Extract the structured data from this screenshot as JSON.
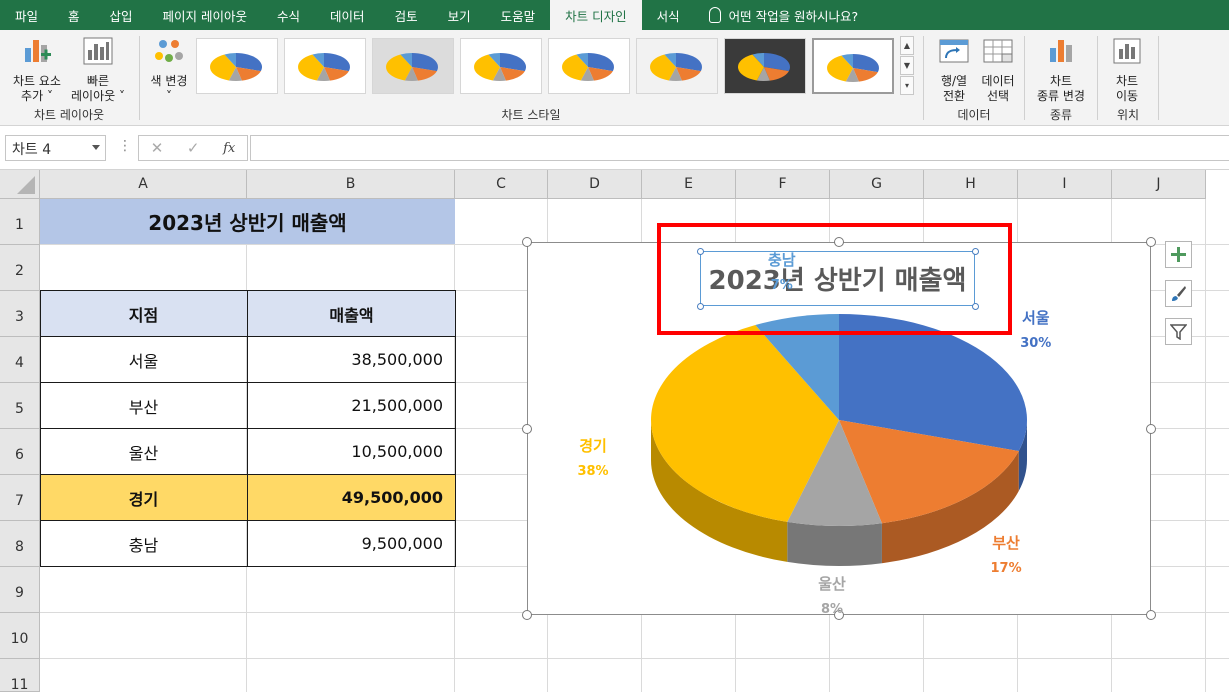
{
  "ribbon_tabs": [
    "파일",
    "홈",
    "삽입",
    "페이지 레이아웃",
    "수식",
    "데이터",
    "검토",
    "보기",
    "도움말",
    "차트 디자인",
    "서식"
  ],
  "active_tab": "차트 디자인",
  "tell_me": "어떤 작업을 원하시나요?",
  "ribbon": {
    "add_element": [
      "차트 요소",
      "추가 ˅"
    ],
    "quick_layout": [
      "빠른",
      "레이아웃 ˅"
    ],
    "group_layout": "차트 레이아웃",
    "change_color": [
      "색 변경",
      "˅"
    ],
    "group_styles": "차트 스타일",
    "switch_row_col": [
      "행/열",
      "전환"
    ],
    "select_data": [
      "데이터",
      "선택"
    ],
    "group_data": "데이터",
    "change_type": [
      "차트",
      "종류 변경"
    ],
    "group_type": "종류",
    "move_chart": [
      "차트",
      "이동"
    ],
    "group_location": "위치"
  },
  "formula_bar": {
    "name_box": "차트 4",
    "fx": "fx",
    "cancel": "✕",
    "confirm": "✓"
  },
  "columns": [
    "A",
    "B",
    "C",
    "D",
    "E",
    "F",
    "G",
    "H",
    "I",
    "J"
  ],
  "rows": [
    "1",
    "2",
    "3",
    "4",
    "5",
    "6",
    "7",
    "8",
    "9",
    "10",
    "11"
  ],
  "sheet": {
    "title": "2023년 상반기 매출액",
    "headers": [
      "지점",
      "매출액"
    ],
    "records": [
      {
        "branch": "서울",
        "amount": "38,500,000"
      },
      {
        "branch": "부산",
        "amount": "21,500,000"
      },
      {
        "branch": "울산",
        "amount": "10,500,000"
      },
      {
        "branch": "경기",
        "amount": "49,500,000"
      },
      {
        "branch": "충남",
        "amount": "9,500,000"
      }
    ]
  },
  "colors": {
    "ribbon_green": "#217346",
    "title_fill": "#b4c6e7",
    "header_fill": "#d9e1f2",
    "highlight_fill": "#ffd966",
    "callout": "#ff0000"
  },
  "chart_data": {
    "type": "pie",
    "title": "2023년 상반기 매출액",
    "three_d": true,
    "categories": [
      "서울",
      "부산",
      "울산",
      "경기",
      "충남"
    ],
    "values": [
      38500000,
      21500000,
      10500000,
      49500000,
      9500000
    ],
    "percent_labels": [
      "30%",
      "17%",
      "8%",
      "38%",
      "7%"
    ],
    "colors": [
      "#4472c4",
      "#ed7d31",
      "#a5a5a5",
      "#ffc000",
      "#5b9bd5"
    ],
    "label_colors": [
      "#4472c4",
      "#ed7d31",
      "#a5a5a5",
      "#ffc000",
      "#5b9bd5"
    ],
    "legend": "none"
  }
}
